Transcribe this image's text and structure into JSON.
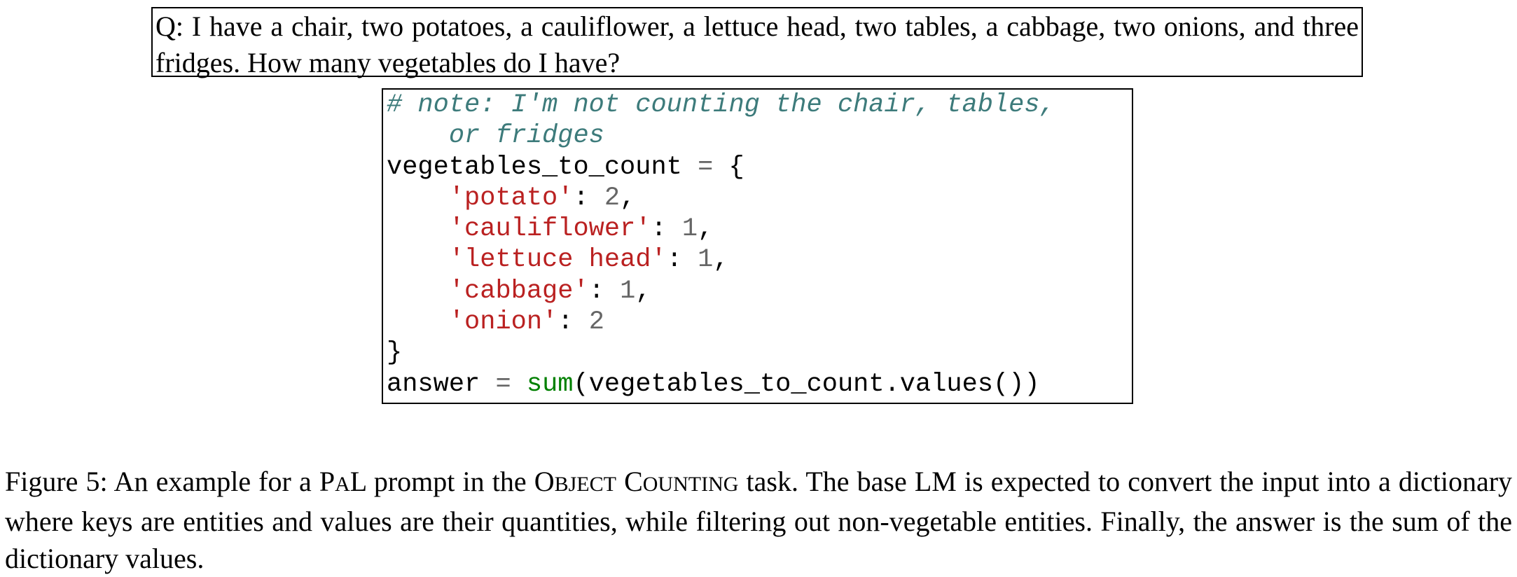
{
  "question": "Q: I have a chair, two potatoes, a cauliflower, a lettuce head, two tables, a cabbage, two onions, and three fridges. How many vegetables do I have?",
  "code": {
    "comment_line1": "# note: I'm not counting the chair, tables,",
    "comment_line2": "or fridges",
    "dict_var": "vegetables_to_count",
    "equals": "=",
    "open_brace": "{",
    "close_brace": "}",
    "entries": [
      {
        "key": "'potato'",
        "value": "2",
        "trail": ","
      },
      {
        "key": "'cauliflower'",
        "value": "1",
        "trail": ","
      },
      {
        "key": "'lettuce head'",
        "value": "1",
        "trail": ","
      },
      {
        "key": "'cabbage'",
        "value": "1",
        "trail": ","
      },
      {
        "key": "'onion'",
        "value": "2",
        "trail": ""
      }
    ],
    "answer_var": "answer",
    "sum_fn": "sum",
    "sum_args": "(vegetables_to_count.values())"
  },
  "caption": {
    "prefix": "Figure 5: An example for a ",
    "pal_p": "P",
    "pal_a": "a",
    "pal_l": "L",
    "mid1": " prompt in the ",
    "obj_o": "O",
    "obj_rest": "bject",
    "space": " ",
    "cnt_c": "C",
    "cnt_rest": "ounting",
    "suffix": " task. The base LM is expected to convert the input into a dictionary where keys are entities and values are their quantities, while filtering out non-vegetable entities. Finally, the answer is the sum of the dictionary values."
  },
  "colors": {
    "comment": "#3d7b7b",
    "string": "#ba2121",
    "number": "#666666",
    "builtin": "#008000"
  }
}
